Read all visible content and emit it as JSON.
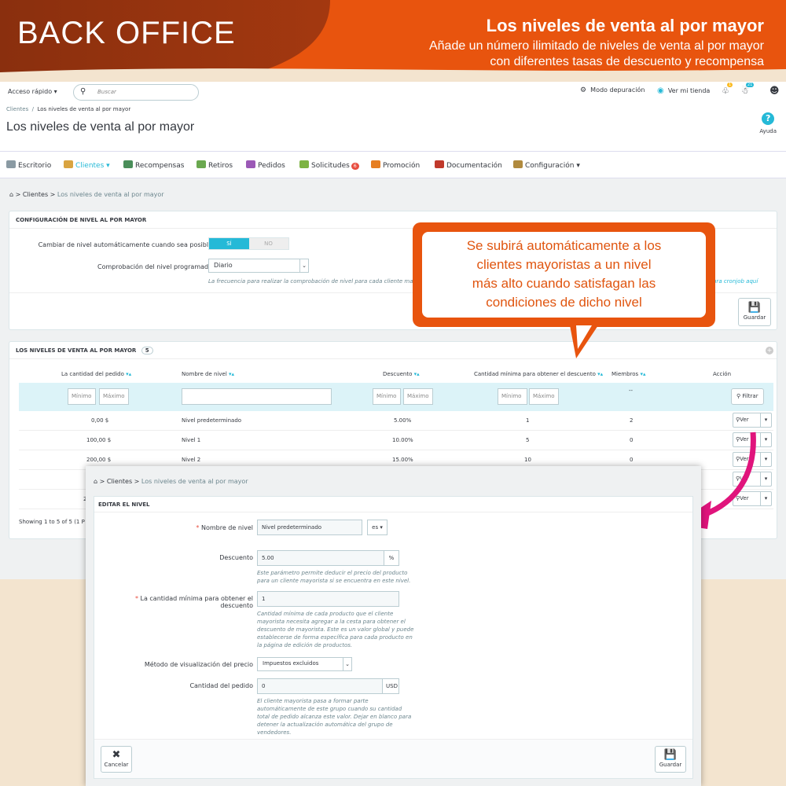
{
  "banner": {
    "left_title": "BACK OFFICE",
    "title": "Los niveles de venta al por mayor",
    "subtitle_line1": "Añade un número ilimitado de niveles de venta al por mayor",
    "subtitle_line2": "con diferentes tasas de descuento y recompensa"
  },
  "topbar": {
    "quick_access": "Acceso rápido ▾",
    "search_placeholder": "Buscar",
    "debug_mode": "Modo depuración",
    "view_store": "Ver mi tienda",
    "notif_count_1": "1",
    "notif_count_2": "21"
  },
  "header": {
    "breadcrumb_parent": "Clientes",
    "breadcrumb_sep": "/",
    "breadcrumb_current": "Los niveles de venta al por mayor",
    "page_title": "Los niveles de venta al por mayor",
    "help_label": "Ayuda"
  },
  "nav": {
    "items": [
      {
        "label": "Escritorio"
      },
      {
        "label": "Clientes ▾"
      },
      {
        "label": "Recompensas"
      },
      {
        "label": "Retiros"
      },
      {
        "label": "Pedidos"
      },
      {
        "label": "Solicitudes"
      },
      {
        "label": "Promoción"
      },
      {
        "label": "Documentación"
      },
      {
        "label": "Configuración ▾"
      }
    ],
    "requests_badge": "6"
  },
  "breadcrumb2": {
    "home_sep": ">",
    "parent": "Clientes",
    "sep": ">",
    "current": "Los niveles de venta al por mayor"
  },
  "config": {
    "header": "CONFIGURACIÓN DE NIVEL AL POR MAYOR",
    "auto_label": "Cambiar de nivel automáticamente cuando sea posible",
    "yes": "SÍ",
    "no": "NO",
    "check_label": "Comprobación del nivel programado",
    "check_value": "Diario",
    "check_hint": "La frecuencia para realizar la comprobación de nivel para cada cliente mayor",
    "cron_link": "ura cronjob aquí",
    "save": "Guardar"
  },
  "list": {
    "header": "LOS NIVELES DE VENTA AL POR MAYOR",
    "count": "5",
    "columns": [
      "La cantidad del pedido",
      "Nombre de nivel",
      "Descuento",
      "Cantidad mínima para obtener el descuento",
      "Miembros",
      "Acción"
    ],
    "min_placeholder": "Mínimo",
    "max_placeholder": "Máximo",
    "members_filter": "--",
    "filter_btn": "Filtrar",
    "view_btn": "Ver",
    "rows": [
      {
        "amount": "0,00 $",
        "name": "Nivel predeterminado",
        "discount": "5.00%",
        "min_qty": "1",
        "members": "2"
      },
      {
        "amount": "100,00 $",
        "name": "Nivel 1",
        "discount": "10.00%",
        "min_qty": "5",
        "members": "0"
      },
      {
        "amount": "200,00 $",
        "name": "Nivel 2",
        "discount": "15.00%",
        "min_qty": "10",
        "members": "0"
      }
    ],
    "partial_amount": "2",
    "showing": "Showing 1 to 5 of 5 (1 P"
  },
  "callout": {
    "text_line1": "Se subirá automáticamente a los",
    "text_line2": "clientes mayoristas a un nivel",
    "text_line3": "más alto cuando satisfagan las",
    "text_line4": "condiciones de dicho nivel"
  },
  "edit": {
    "breadcrumb_parent": "Clientes",
    "breadcrumb_current": "Los niveles de venta al por mayor",
    "header": "EDITAR EL NIVEL",
    "name_label": "Nombre de nivel",
    "name_value": "Nivel predeterminado",
    "lang": "es ▾",
    "discount_label": "Descuento",
    "discount_value": "5.00",
    "discount_unit": "%",
    "discount_hint1": "Este parámetro permite deducir el precio del producto",
    "discount_hint2": "para un cliente mayorista si se encuentra en este nivel.",
    "minqty_label": "La cantidad mínima para obtener el descuento",
    "minqty_value": "1",
    "minqty_hint": [
      "Cantidad mínima de cada producto que el cliente",
      "mayorista necesita agregar a la cesta para obtener el",
      "descuento de mayorista. Este es un valor global y puede",
      "establecerse de forma específica para cada producto en",
      "la página de edición de productos."
    ],
    "price_label": "Método de visualización del precio",
    "price_value": "Impuestos excluidos",
    "order_label": "Cantidad del pedido",
    "order_value": "0",
    "order_unit": "USD",
    "order_hint": [
      "El cliente mayorista pasa a formar parte",
      "automáticamente de este grupo cuando su cantidad",
      "total de pedido alcanza este valor. Dejar en blanco para",
      "detener la actualización automática del grupo de",
      "vendedores."
    ],
    "cancel": "Cancelar",
    "save": "Guardar"
  },
  "colors": {
    "banner_dark": "#7a2a0c",
    "banner_orange": "#e8540e",
    "accent": "#25b9d7",
    "arrow": "#e0147c"
  }
}
